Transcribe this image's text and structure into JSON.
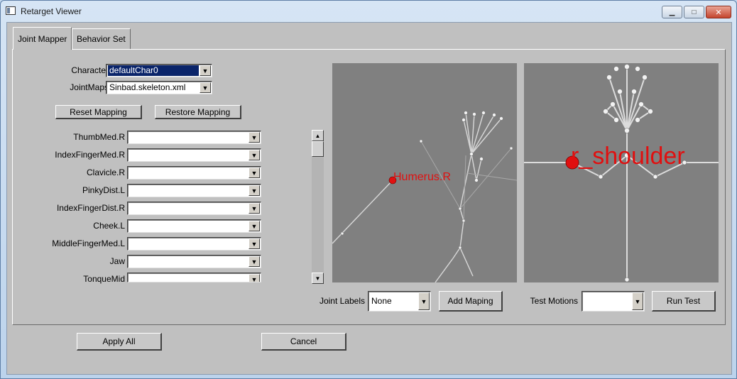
{
  "window": {
    "title": "Retarget Viewer",
    "minimize_glyph": "▁",
    "maximize_glyph": "□",
    "close_glyph": "✕"
  },
  "tabs": [
    {
      "label": "Joint Mapper",
      "active": true
    },
    {
      "label": "Behavior Set",
      "active": false
    }
  ],
  "joint_mapper": {
    "character_label": "Character",
    "character_value": "defaultChar0",
    "jointmaps_label": "JointMaps",
    "jointmaps_value": "Sinbad.skeleton.xml",
    "reset_label": "Reset Mapping",
    "restore_label": "Restore Mapping",
    "joints": [
      {
        "name": "ThumbMed.R",
        "value": ""
      },
      {
        "name": "IndexFingerMed.R",
        "value": ""
      },
      {
        "name": "Clavicle.R",
        "value": ""
      },
      {
        "name": "PinkyDist.L",
        "value": ""
      },
      {
        "name": "IndexFingerDist.R",
        "value": ""
      },
      {
        "name": "Cheek.L",
        "value": ""
      },
      {
        "name": "MiddleFingerMed.L",
        "value": ""
      },
      {
        "name": "Jaw",
        "value": ""
      },
      {
        "name": "TonqueMid",
        "value": ""
      }
    ],
    "source_view_label": "Humerus.R",
    "target_view_label": "r_shoulder",
    "joint_labels_label": "Joint Labels",
    "joint_labels_value": "None",
    "add_mapping_label": "Add Maping",
    "test_motions_label": "Test Motions",
    "test_motions_value": "",
    "run_test_label": "Run Test"
  },
  "footer": {
    "apply_all_label": "Apply All",
    "cancel_label": "Cancel"
  },
  "colors": {
    "viewport_bg": "#808080",
    "bone": "#dcdcdc",
    "highlight": "#e01010"
  },
  "icons": {
    "dropdown": "▼",
    "scroll_up": "▲",
    "scroll_down": "▼"
  }
}
